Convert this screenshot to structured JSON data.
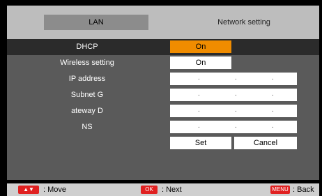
{
  "tabs": {
    "lan": "LAN",
    "network_setting": "Network setting"
  },
  "rows": {
    "dhcp": {
      "label": "DHCP",
      "value": "On"
    },
    "wireless": {
      "label": "Wireless setting",
      "value": "On"
    },
    "ip": {
      "label": "IP address"
    },
    "subnet": {
      "label": "Subnet  G"
    },
    "gateway": {
      "label": "ateway  D"
    },
    "dns": {
      "label": "NS"
    }
  },
  "ip_dots": ".",
  "buttons": {
    "set": "Set",
    "cancel": "Cancel"
  },
  "status": {
    "move_key": "▲▼",
    "move": ": Move",
    "ok_key": "OK",
    "next": ": Next",
    "menu_key": "MENU",
    "back": ": Back"
  },
  "colors": {
    "accent": "#f08c00",
    "key_red": "#e02020"
  }
}
